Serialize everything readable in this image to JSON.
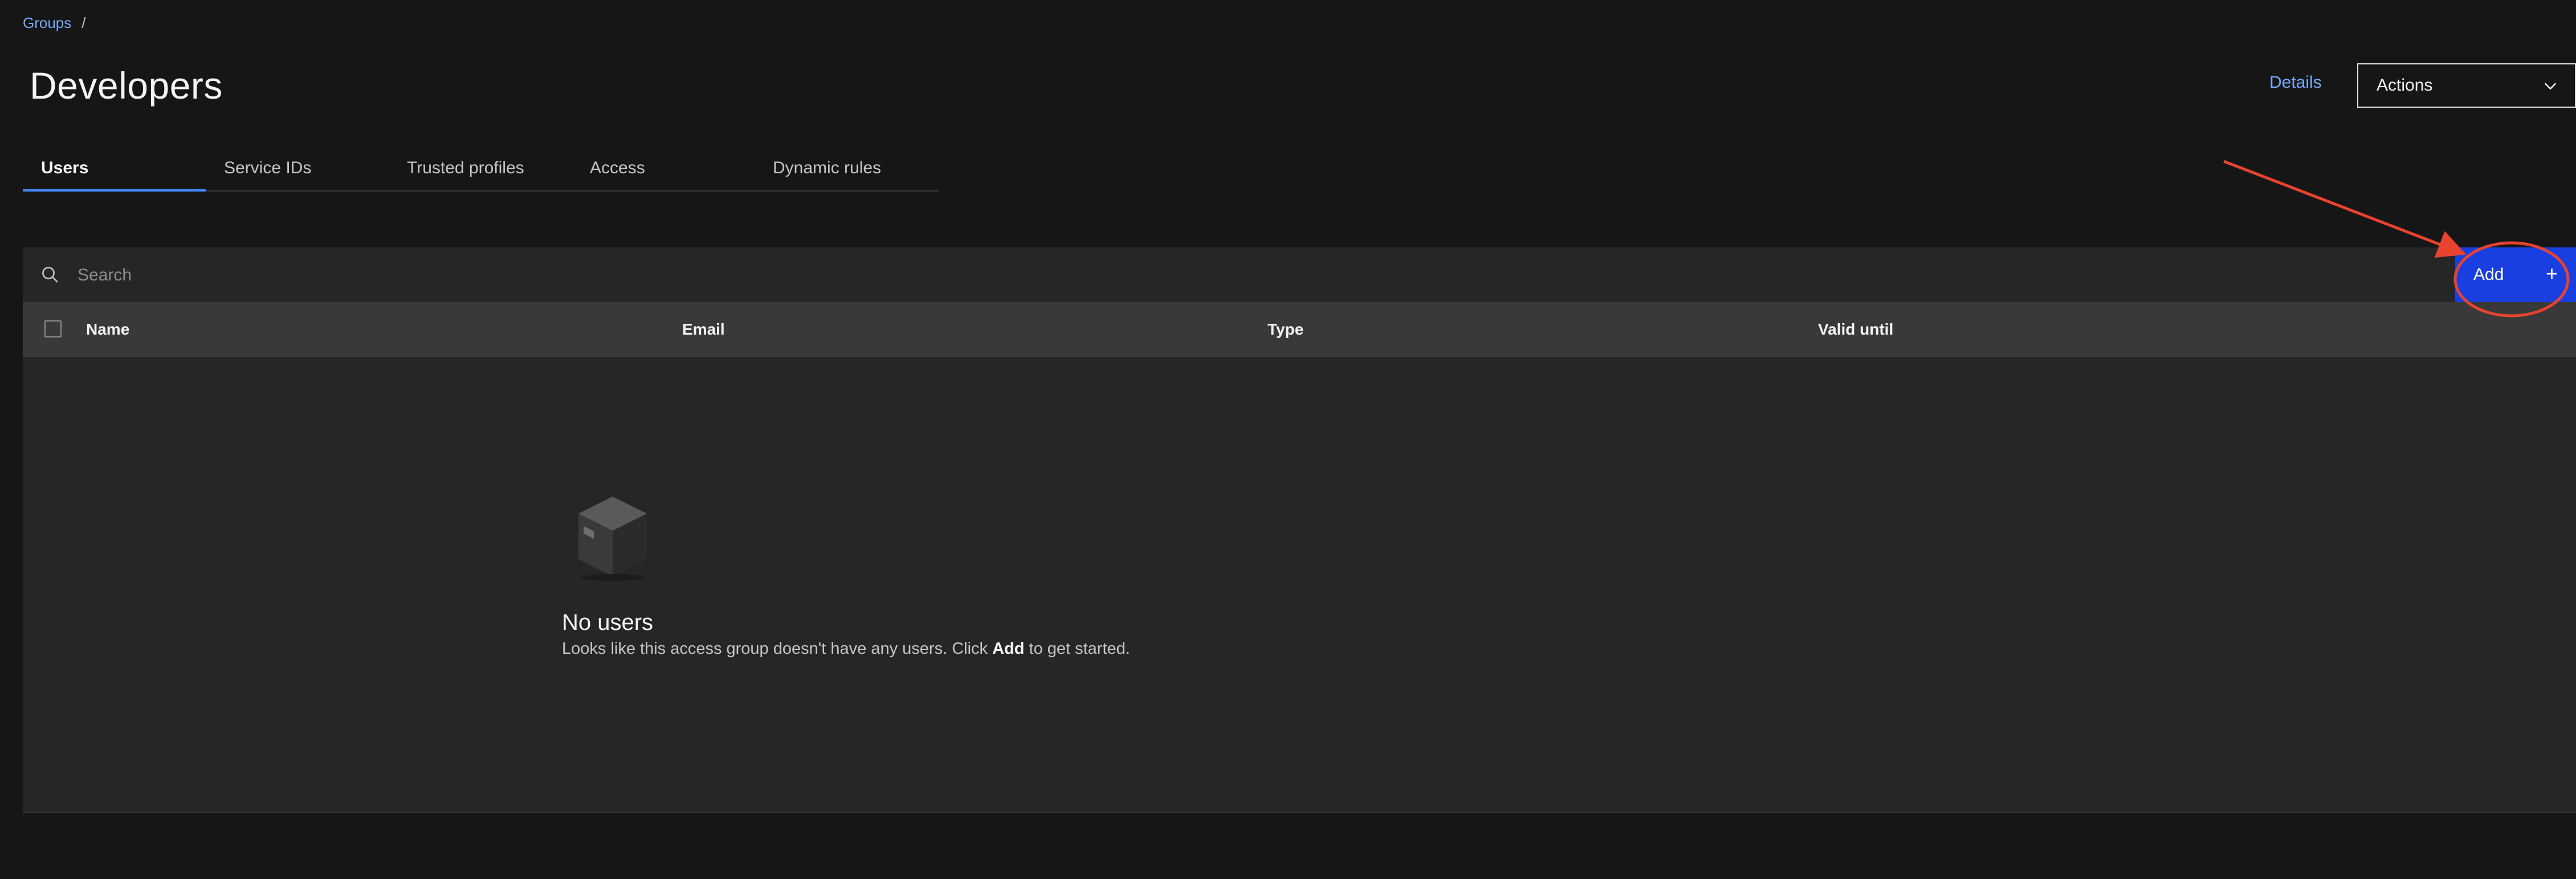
{
  "breadcrumb": {
    "parent": "Groups",
    "separator": "/"
  },
  "header": {
    "title": "Developers",
    "details_label": "Details",
    "actions_label": "Actions"
  },
  "tabs": [
    {
      "label": "Users",
      "active": true
    },
    {
      "label": "Service IDs",
      "active": false
    },
    {
      "label": "Trusted profiles",
      "active": false
    },
    {
      "label": "Access",
      "active": false
    },
    {
      "label": "Dynamic rules",
      "active": false
    }
  ],
  "toolbar": {
    "search_placeholder": "Search",
    "add_label": "Add",
    "add_icon": "+"
  },
  "table": {
    "columns": [
      "Name",
      "Email",
      "Type",
      "Valid until"
    ]
  },
  "empty_state": {
    "title": "No users",
    "description_before": "Looks like this access group doesn't have any users. Click ",
    "description_bold": "Add",
    "description_after": " to get started."
  },
  "colors": {
    "background": "#161616",
    "link": "#78a9ff",
    "primary_button": "#1a3fe0",
    "annotation": "#e8432e"
  },
  "icons": [
    "search-icon",
    "chevron-down-icon",
    "add-icon",
    "empty-box-icon"
  ]
}
